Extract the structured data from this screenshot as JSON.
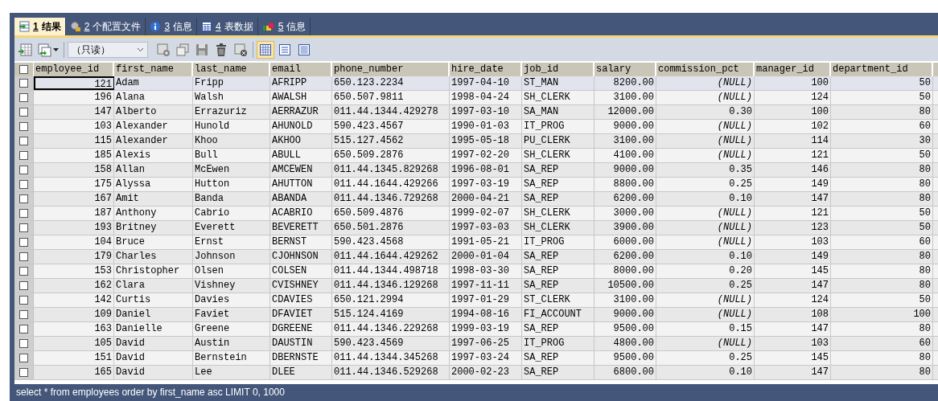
{
  "tabs": [
    {
      "key": "1",
      "label": "结果",
      "selected": true
    },
    {
      "key": "2",
      "label": "个配置文件",
      "selected": false
    },
    {
      "key": "3",
      "label": "信息",
      "selected": false
    },
    {
      "key": "4",
      "label": "表数据",
      "selected": false
    },
    {
      "key": "5",
      "label": "信息",
      "selected": false
    }
  ],
  "toolbar": {
    "mode_select": {
      "value": "（只读）"
    },
    "view_modes": [
      {
        "selected": true
      },
      {
        "selected": false
      },
      {
        "selected": false
      }
    ]
  },
  "table": {
    "select_all_checked": false,
    "columns": [
      "employee_id",
      "first_name",
      "last_name",
      "email",
      "phone_number",
      "hire_date",
      "job_id",
      "salary",
      "commission_pct",
      "manager_id",
      "department_id"
    ],
    "rows": [
      {
        "selected": true,
        "checked": false,
        "cells": [
          "121",
          "Adam",
          "Fripp",
          "AFRIPP",
          "650.123.2234",
          "1997-04-10",
          "ST_MAN",
          "8200.00",
          {
            "text": "(NULL)",
            "kind": "null"
          },
          "100",
          "50"
        ]
      },
      {
        "selected": false,
        "checked": false,
        "cells": [
          "196",
          "Alana",
          "Walsh",
          "AWALSH",
          "650.507.9811",
          "1998-04-24",
          "SH_CLERK",
          "3100.00",
          {
            "text": "(NULL)",
            "kind": "null"
          },
          "124",
          "50"
        ]
      },
      {
        "selected": false,
        "checked": false,
        "cells": [
          "147",
          "Alberto",
          "Errazuriz",
          "AERRAZUR",
          "011.44.1344.429278",
          "1997-03-10",
          "SA_MAN",
          "12000.00",
          "0.30",
          "100",
          "80"
        ]
      },
      {
        "selected": false,
        "checked": false,
        "cells": [
          "103",
          "Alexander",
          "Hunold",
          "AHUNOLD",
          "590.423.4567",
          "1990-01-03",
          "IT_PROG",
          "9000.00",
          {
            "text": "(NULL)",
            "kind": "null"
          },
          "102",
          "60"
        ]
      },
      {
        "selected": false,
        "checked": false,
        "cells": [
          "115",
          "Alexander",
          "Khoo",
          "AKHOO",
          "515.127.4562",
          "1995-05-18",
          "PU_CLERK",
          "3100.00",
          {
            "text": "(NULL)",
            "kind": "null"
          },
          "114",
          "30"
        ]
      },
      {
        "selected": false,
        "checked": false,
        "cells": [
          "185",
          "Alexis",
          "Bull",
          "ABULL",
          "650.509.2876",
          "1997-02-20",
          "SH_CLERK",
          "4100.00",
          {
            "text": "(NULL)",
            "kind": "null"
          },
          "121",
          "50"
        ]
      },
      {
        "selected": false,
        "checked": false,
        "cells": [
          "158",
          "Allan",
          "McEwen",
          "AMCEWEN",
          "011.44.1345.829268",
          "1996-08-01",
          "SA_REP",
          "9000.00",
          "0.35",
          "146",
          "80"
        ]
      },
      {
        "selected": false,
        "checked": false,
        "cells": [
          "175",
          "Alyssa",
          "Hutton",
          "AHUTTON",
          "011.44.1644.429266",
          "1997-03-19",
          "SA_REP",
          "8800.00",
          "0.25",
          "149",
          "80"
        ]
      },
      {
        "selected": false,
        "checked": false,
        "cells": [
          "167",
          "Amit",
          "Banda",
          "ABANDA",
          "011.44.1346.729268",
          "2000-04-21",
          "SA_REP",
          "6200.00",
          "0.10",
          "147",
          "80"
        ]
      },
      {
        "selected": false,
        "checked": false,
        "cells": [
          "187",
          "Anthony",
          "Cabrio",
          "ACABRIO",
          "650.509.4876",
          "1999-02-07",
          "SH_CLERK",
          "3000.00",
          {
            "text": "(NULL)",
            "kind": "null"
          },
          "121",
          "50"
        ]
      },
      {
        "selected": false,
        "checked": false,
        "cells": [
          "193",
          "Britney",
          "Everett",
          "BEVERETT",
          "650.501.2876",
          "1997-03-03",
          "SH_CLERK",
          "3900.00",
          {
            "text": "(NULL)",
            "kind": "null"
          },
          "123",
          "50"
        ]
      },
      {
        "selected": false,
        "checked": false,
        "cells": [
          "104",
          "Bruce",
          "Ernst",
          "BERNST",
          "590.423.4568",
          "1991-05-21",
          "IT_PROG",
          "6000.00",
          {
            "text": "(NULL)",
            "kind": "null"
          },
          "103",
          "60"
        ]
      },
      {
        "selected": false,
        "checked": false,
        "cells": [
          "179",
          "Charles",
          "Johnson",
          "CJOHNSON",
          "011.44.1644.429262",
          "2000-01-04",
          "SA_REP",
          "6200.00",
          "0.10",
          "149",
          "80"
        ]
      },
      {
        "selected": false,
        "checked": false,
        "cells": [
          "153",
          "Christopher",
          "Olsen",
          "COLSEN",
          "011.44.1344.498718",
          "1998-03-30",
          "SA_REP",
          "8000.00",
          "0.20",
          "145",
          "80"
        ]
      },
      {
        "selected": false,
        "checked": false,
        "cells": [
          "162",
          "Clara",
          "Vishney",
          "CVISHNEY",
          "011.44.1346.129268",
          "1997-11-11",
          "SA_REP",
          "10500.00",
          "0.25",
          "147",
          "80"
        ]
      },
      {
        "selected": false,
        "checked": false,
        "cells": [
          "142",
          "Curtis",
          "Davies",
          "CDAVIES",
          "650.121.2994",
          "1997-01-29",
          "ST_CLERK",
          "3100.00",
          {
            "text": "(NULL)",
            "kind": "null"
          },
          "124",
          "50"
        ]
      },
      {
        "selected": false,
        "checked": false,
        "cells": [
          "109",
          "Daniel",
          "Faviet",
          "DFAVIET",
          "515.124.4169",
          "1994-08-16",
          "FI_ACCOUNT",
          "9000.00",
          {
            "text": "(NULL)",
            "kind": "null"
          },
          "108",
          "100"
        ]
      },
      {
        "selected": false,
        "checked": false,
        "cells": [
          "163",
          "Danielle",
          "Greene",
          "DGREENE",
          "011.44.1346.229268",
          "1999-03-19",
          "SA_REP",
          "9500.00",
          "0.15",
          "147",
          "80"
        ]
      },
      {
        "selected": false,
        "checked": false,
        "cells": [
          "105",
          "David",
          "Austin",
          "DAUSTIN",
          "590.423.4569",
          "1997-06-25",
          "IT_PROG",
          "4800.00",
          {
            "text": "(NULL)",
            "kind": "null"
          },
          "103",
          "60"
        ]
      },
      {
        "selected": false,
        "checked": false,
        "cells": [
          "151",
          "David",
          "Bernstein",
          "DBERNSTE",
          "011.44.1344.345268",
          "1997-03-24",
          "SA_REP",
          "9500.00",
          "0.25",
          "145",
          "80"
        ]
      },
      {
        "selected": false,
        "checked": false,
        "cells": [
          "165",
          "David",
          "Lee",
          "DLEE",
          "011.44.1346.529268",
          "2000-02-23",
          "SA_REP",
          "6800.00",
          "0.10",
          "147",
          "80"
        ]
      }
    ]
  },
  "status_bar": "select * from employees order by first_name asc LIMIT 0, 1000"
}
